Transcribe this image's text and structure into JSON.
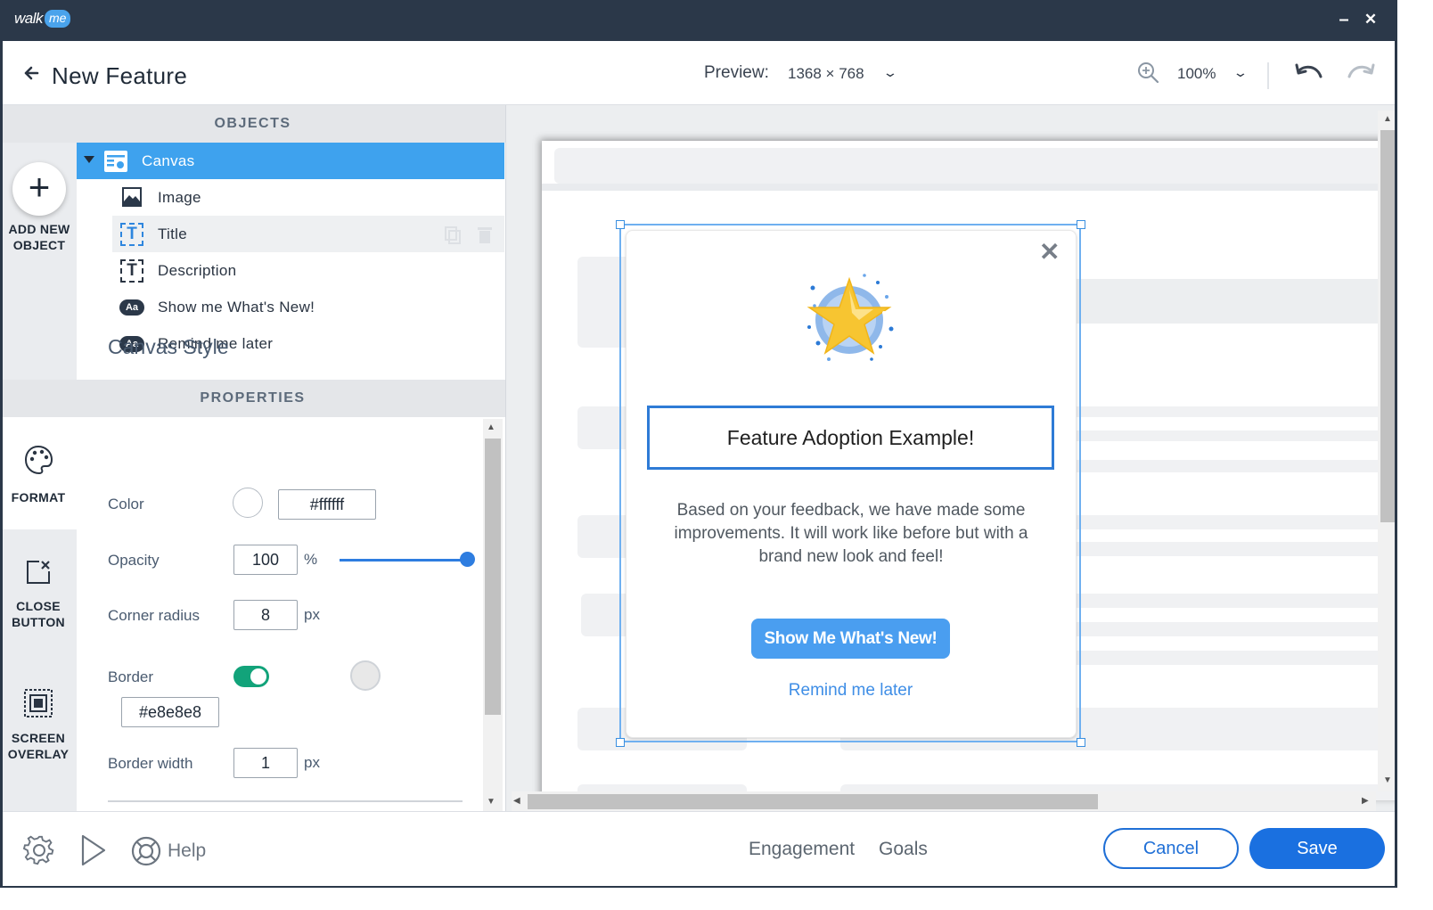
{
  "app": {
    "logo_walk": "walk",
    "logo_me": "me",
    "minimize": "–",
    "close": "✕"
  },
  "header": {
    "title": "New Feature",
    "preview_label": "Preview:",
    "preview_resolution": "1368 × 768",
    "zoom": "100%"
  },
  "objects": {
    "heading": "OBJECTS",
    "add_label_line1": "ADD NEW",
    "add_label_line2": "OBJECT",
    "items": [
      {
        "label": "Canvas"
      },
      {
        "label": "Image"
      },
      {
        "label": "Title"
      },
      {
        "label": "Description"
      },
      {
        "label": "Show me What's New!"
      },
      {
        "label": "Remind me later"
      }
    ],
    "aa_badge": "Aa",
    "t_glyph": "T"
  },
  "properties": {
    "heading": "PROPERTIES",
    "tabs": [
      {
        "label": "FORMAT",
        "icon": "palette-icon"
      },
      {
        "label_line1": "CLOSE",
        "label_line2": "BUTTON",
        "icon": "close-button-icon"
      },
      {
        "label_line1": "SCREEN",
        "label_line2": "OVERLAY",
        "icon": "screen-overlay-icon"
      }
    ],
    "section_title": "Canvas Style",
    "color_label": "Color",
    "color_value": "#ffffff",
    "opacity_label": "Opacity",
    "opacity_value": "100",
    "opacity_unit": "%",
    "opacity_level": 1.0,
    "corner_label": "Corner radius",
    "corner_value": "8",
    "corner_unit": "px",
    "border_label": "Border",
    "border_enabled": true,
    "border_color_value": "#e8e8e8",
    "border_width_label": "Border width",
    "border_width_value": "1",
    "border_width_unit": "px"
  },
  "popup": {
    "close": "✕",
    "title": "Feature Adoption Example!",
    "description": "Based on your feedback, we have made some improvements. It will work like before but with a brand new look and feel!",
    "cta": "Show Me What's New!",
    "secondary": "Remind me later"
  },
  "footer": {
    "help": "Help",
    "engagement": "Engagement",
    "goals": "Goals",
    "cancel": "Cancel",
    "save": "Save"
  },
  "colors": {
    "titlebar": "#2b3849",
    "accent": "#1a70e0",
    "selected_row": "#3ea2ee",
    "toggle_on": "#12a37a",
    "popup_button": "#4a9ef0"
  }
}
